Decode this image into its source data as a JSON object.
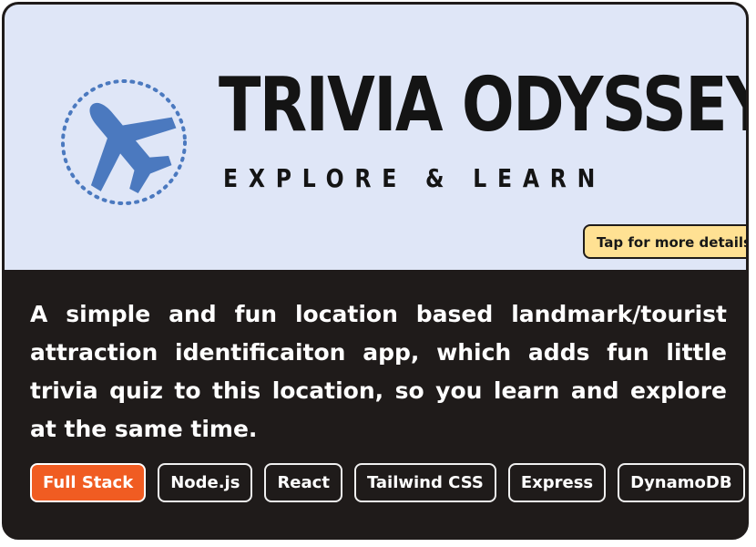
{
  "hero": {
    "icon": "airplane-icon",
    "title": "TRIVIA ODYSSEY",
    "subtitle": "EXPLORE & LEARN",
    "details_button": "Tap for more details",
    "colors": {
      "background": "#dfe6f7",
      "icon_blue": "#4b79bf",
      "title": "#141414",
      "button_background": "#ffe193"
    }
  },
  "project": {
    "description": "A simple and fun location based landmark/tourist attraction identificaiton app, which adds fun little trivia quiz to this location, so you learn and explore at the same time.",
    "tags": [
      "Full Stack",
      "Node.js",
      "React",
      "Tailwind CSS",
      "Express",
      "DynamoDB"
    ],
    "colors": {
      "card_background": "#1f1b1a",
      "active_tag": "#f05c22"
    }
  }
}
